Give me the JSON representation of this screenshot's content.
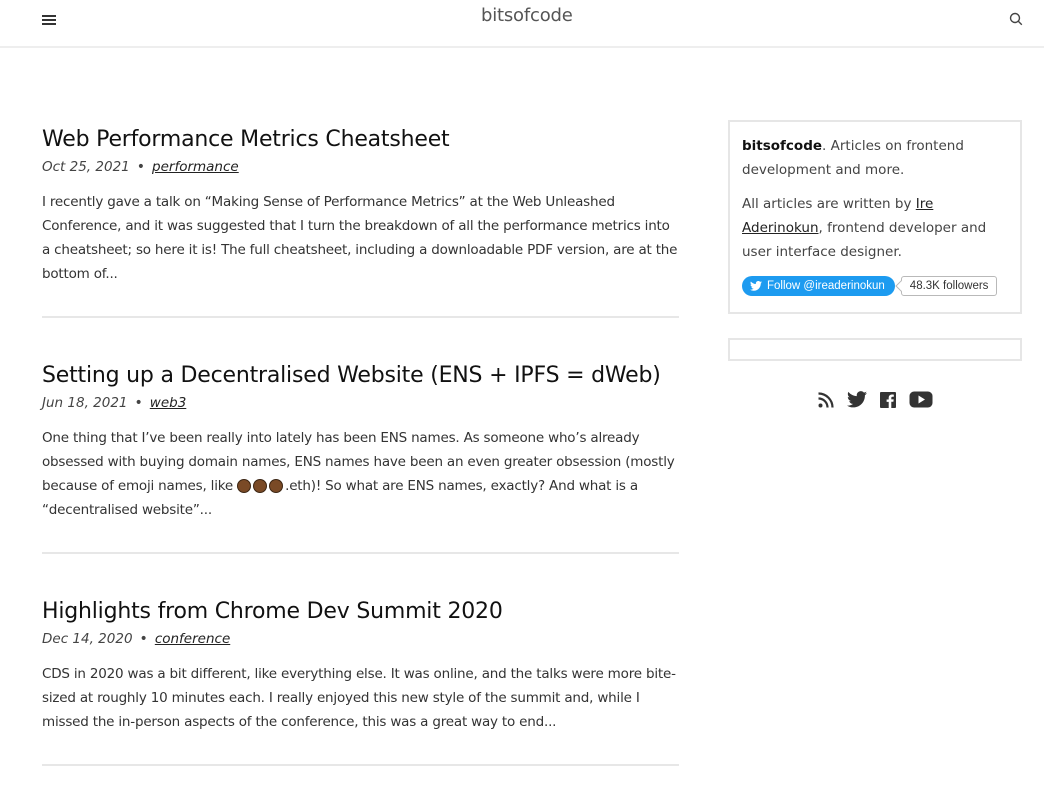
{
  "header": {
    "logo": "bitsofcode",
    "menu_icon": "hamburger-menu-icon",
    "search_icon": "search-icon"
  },
  "articles": [
    {
      "title": "Web Performance Metrics Cheatsheet",
      "date": "Oct 25, 2021",
      "tag": "performance",
      "excerpt": "I recently gave a talk on “Making Sense of Performance Metrics” at the Web Unleashed Conference, and it was suggested that I turn the breakdown of all the performance metrics into a cheatsheet; so here it is! The full cheatsheet, including a downloadable PDF version, are at the bottom of..."
    },
    {
      "title": "Setting up a Decentralised Website (ENS + IPFS = dWeb)",
      "date": "Jun 18, 2021",
      "tag": "web3",
      "excerpt_before_emoji": "One thing that I’ve been really into lately has been ENS names. As someone who’s already obsessed with buying domain names, ENS names have been an even greater obsession (mostly because of emoji names, like ",
      "excerpt_after_emoji": ".eth)! So what are ENS names, exactly? And what is a “decentralised website”..."
    },
    {
      "title": "Highlights from Chrome Dev Summit 2020",
      "date": "Dec 14, 2020",
      "tag": "conference",
      "excerpt": "CDS in 2020 was a bit different, like everything else. It was online, and the talks were more bite-sized at roughly 10 minutes each. I really enjoyed this new style of the summit and, while I missed the in-person aspects of the conference, this was a great way to end..."
    }
  ],
  "sidebar": {
    "site_name": "bitsofcode",
    "tagline": ". Articles on frontend development and more.",
    "author_prefix": "All articles are written by ",
    "author_name": "Ire Aderinokun",
    "author_suffix": ", frontend developer and user interface designer.",
    "twitter_follow": "Follow @ireaderinokun",
    "twitter_followers": "48.3K followers",
    "social_icons": [
      "rss-icon",
      "twitter-icon",
      "facebook-icon",
      "youtube-icon"
    ]
  },
  "colors": {
    "twitter_blue": "#1d9bf0",
    "border": "#e6e6e6"
  }
}
